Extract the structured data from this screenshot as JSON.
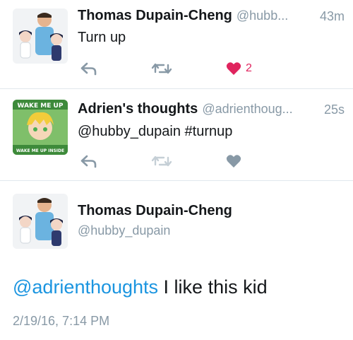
{
  "colors": {
    "link": "#1b95e0",
    "like_active": "#e0245e",
    "icon_gray": "#8899a6",
    "divider": "#e1e8ed"
  },
  "tweets": [
    {
      "display_name": "Thomas Dupain-Cheng",
      "handle": "@hubb...",
      "time": "43m",
      "text": "Turn up",
      "likes": "2",
      "liked": true,
      "avatar_icon": "cartoon-family-avatar"
    },
    {
      "display_name": "Adrien's thoughts",
      "handle": "@adrienthoug...",
      "time": "25s",
      "text": "@hubby_dupain #turnup",
      "liked": false,
      "avatar_icon": "cartoon-blonde-boy-avatar",
      "avatar_banner_top": "WAKE ME UP",
      "avatar_banner_bottom": "WAKE ME UP INSIDE"
    }
  ],
  "detail": {
    "display_name": "Thomas Dupain-Cheng",
    "handle": "@hubby_dupain",
    "mention": "@adrienthoughts",
    "text": " I like this kid",
    "timestamp": "2/19/16, 7:14 PM",
    "avatar_icon": "cartoon-family-avatar"
  }
}
